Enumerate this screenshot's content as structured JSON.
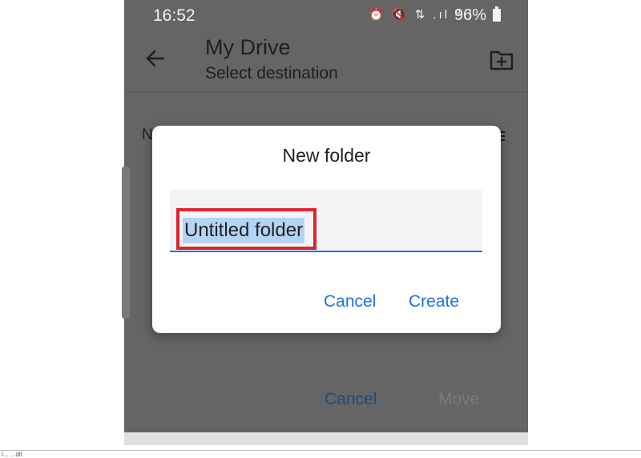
{
  "status_bar": {
    "time": "16:52",
    "icons": "⏰ 🔇 ⇅ .ıl ᴿıl",
    "battery": "96%"
  },
  "app_bar": {
    "title": "My Drive",
    "subtitle": "Select destination",
    "back_icon": "arrow-left",
    "new_folder_icon": "folder-plus"
  },
  "list": {
    "header_letter": "N"
  },
  "bottom_actions": {
    "cancel": "Cancel",
    "move": "Move"
  },
  "dialog": {
    "title": "New folder",
    "field_value": "Untitled folder",
    "cancel": "Cancel",
    "create": "Create"
  },
  "caption": "i...  ...dit",
  "colors": {
    "accent": "#1a73e8",
    "highlight": "#e1212d",
    "scrim": "#656565",
    "selection": "#b5d3f3"
  }
}
